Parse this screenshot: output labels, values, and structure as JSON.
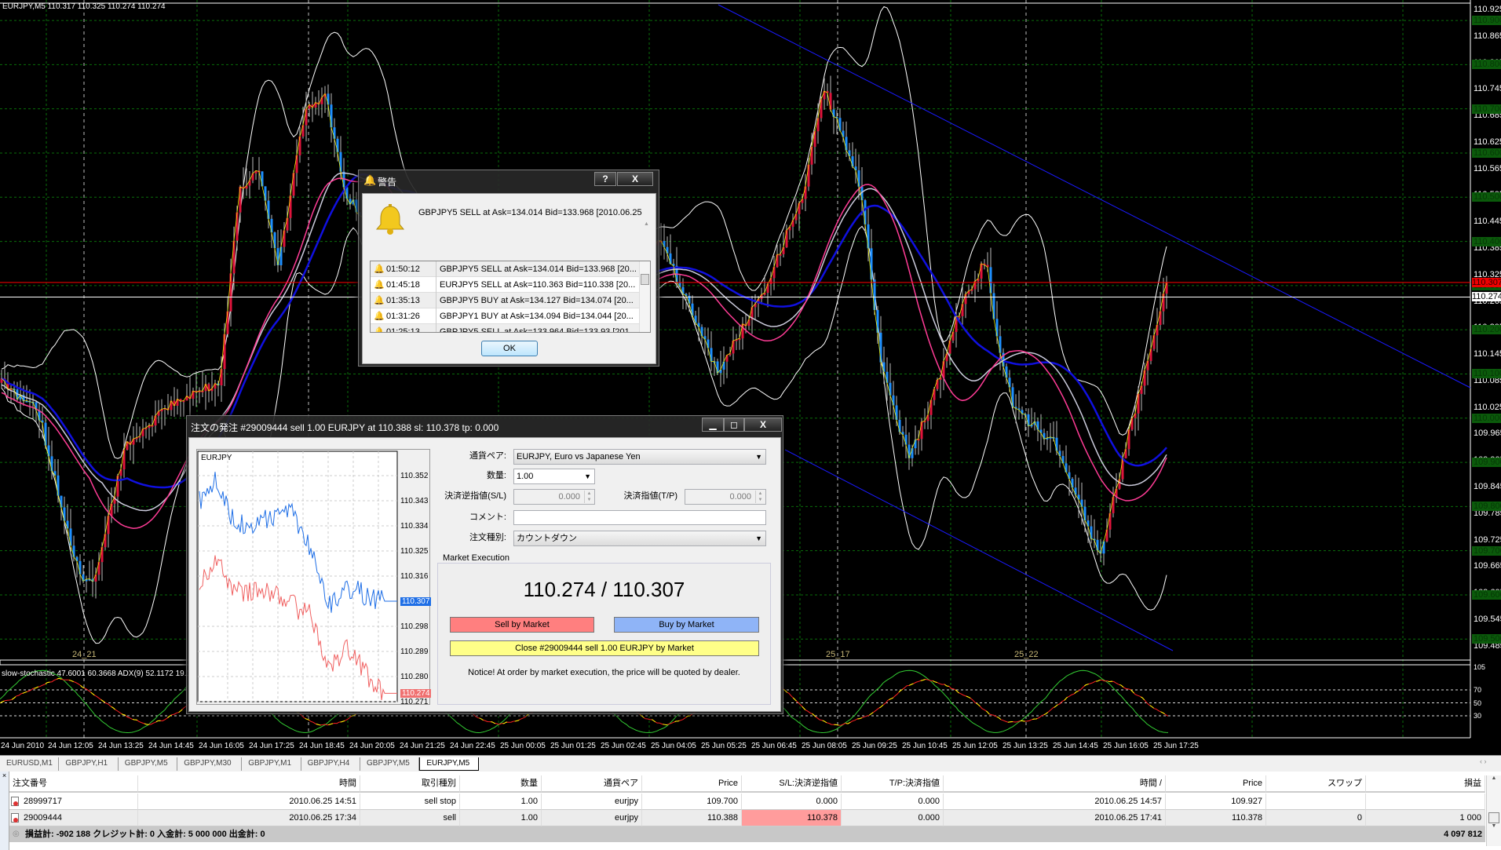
{
  "colors": {
    "bull": "#e0143c",
    "bear": "#1e90ff",
    "band": "#ffffff",
    "ma_slow": "#1010e0",
    "ma_fast": "#ff3c96",
    "grid": "#0a6e0a",
    "channel": "#1a1aff",
    "ask": "#ff0000",
    "bid": "#ffffff",
    "sell_button": "#ff7f7f",
    "buy_button": "#8fb4f7",
    "close_button": "#ffff88"
  },
  "chart": {
    "info": "EURJPY,M5  110.317 110.325 110.274 110.274",
    "price_labels": [
      "110.925",
      "110.865",
      "110.805",
      "110.745",
      "110.685",
      "110.625",
      "110.565",
      "110.505",
      "110.445",
      "110.385",
      "110.325",
      "110.265",
      "110.205",
      "110.145",
      "110.085",
      "110.025",
      "109.965",
      "109.905",
      "109.845",
      "109.785",
      "109.725",
      "109.665",
      "109.605",
      "109.545",
      "109.485"
    ],
    "grid_labels": [
      "110.900",
      "110.800",
      "110.700",
      "110.600",
      "110.500",
      "110.400",
      "110.300",
      "110.200",
      "110.100",
      "110.000",
      "109.900",
      "109.800",
      "109.700",
      "109.600",
      "109.500"
    ],
    "ask": "110.307",
    "bid": "110.274",
    "session_labels": [
      {
        "text": "24_21"
      },
      {
        "text": "25_17"
      },
      {
        "text": "25_22"
      }
    ],
    "indicator_label": "slow-stochastic 47.6001 60.3668  ADX(9) 52.1172 19.17",
    "sub_levels": [
      "105",
      "70",
      "50",
      "30"
    ],
    "time_labels": [
      "24 Jun 2010",
      "24 Jun 12:05",
      "24 Jun 13:25",
      "24 Jun 14:45",
      "24 Jun 16:05",
      "24 Jun 17:25",
      "24 Jun 18:45",
      "24 Jun 20:05",
      "24 Jun 21:25",
      "24 Jun 22:45",
      "25 Jun 00:05",
      "25 Jun 01:25",
      "25 Jun 02:45",
      "25 Jun 04:05",
      "25 Jun 05:25",
      "25 Jun 06:45",
      "25 Jun 08:05",
      "25 Jun 09:25",
      "25 Jun 10:45",
      "25 Jun 12:05",
      "25 Jun 13:25",
      "25 Jun 14:45",
      "25 Jun 16:05",
      "25 Jun 17:25"
    ]
  },
  "alert": {
    "title": "警告",
    "help": "?",
    "close": "X",
    "message": "GBPJPY5 SELL at Ask=134.014 Bid=133.968 [2010.06.25",
    "rows": [
      {
        "time": "01:50:12",
        "text": "GBPJPY5 SELL at Ask=134.014 Bid=133.968 [20..."
      },
      {
        "time": "01:45:18",
        "text": "EURJPY5 SELL at Ask=110.363 Bid=110.338 [20..."
      },
      {
        "time": "01:35:13",
        "text": "GBPJPY5 BUY at Ask=134.127 Bid=134.074 [20..."
      },
      {
        "time": "01:31:26",
        "text": "GBPJPY1 BUY at Ask=134.094 Bid=134.044 [20..."
      },
      {
        "time": "01:25:13",
        "text": "GBPJPY5 SELL at Ask=133.964 Bid=133.93 [201..."
      }
    ],
    "ok": "OK"
  },
  "order": {
    "title": "注文の発注  #29009444 sell 1.00 EURJPY at 110.388 sl: 110.378 tp: 0.000",
    "mini_chart": {
      "symbol": "EURJPY",
      "labels": [
        "110.352",
        "110.343",
        "110.334",
        "110.325",
        "110.316",
        "110.298",
        "110.289",
        "110.280",
        "110.271"
      ],
      "ask": "110.307",
      "bid": "110.274"
    },
    "symbol_label": "通貨ペア:",
    "symbol_value": "EURJPY, Euro vs Japanese Yen",
    "volume_label": "数量:",
    "volume_value": "1.00",
    "sl_label": "決済逆指値(S/L)",
    "sl_value": "0.000",
    "tp_label": "決済指値(T/P)",
    "tp_value": "0.000",
    "comment_label": "コメント:",
    "comment_value": "",
    "type_label": "注文種別:",
    "type_value": "カウントダウン",
    "group_label": "Market Execution",
    "bid": "110.274",
    "ask": "110.307",
    "sep": " / ",
    "sell": "Sell by Market",
    "buy": "Buy by Market",
    "close": "Close  #29009444 sell 1.00 EURJPY by Market",
    "notice": "Notice! At order by market execution, the price will be quoted by dealer."
  },
  "tabs": [
    "EURUSD,M1",
    "GBPJPY,H1",
    "GBPJPY,M5",
    "GBPJPY,M30",
    "GBPJPY,M1",
    "GBPJPY,H4",
    "GBPJPY,M5",
    "EURJPY,M5"
  ],
  "active_tab": "EURJPY,M5",
  "terminal": {
    "headers": [
      "注文番号",
      "時間",
      "取引種別",
      "数量",
      "通貨ペア",
      "Price",
      "S/L:決済逆指値",
      "T/P:決済指値",
      "時間  /",
      "Price",
      "スワップ",
      "損益"
    ],
    "rows": [
      [
        "28999717",
        "2010.06.25 14:51",
        "sell stop",
        "1.00",
        "eurjpy",
        "109.700",
        "0.000",
        "0.000",
        "2010.06.25 14:57",
        "109.927",
        "",
        ""
      ],
      [
        "29009444",
        "2010.06.25 17:34",
        "sell",
        "1.00",
        "eurjpy",
        "110.388",
        "110.378",
        "0.000",
        "2010.06.25 17:41",
        "110.378",
        "0",
        "1 000"
      ]
    ],
    "summary": "損益計: -902 188  クレジット計: 0  入金計: 5 000 000  出金計: 0",
    "total": "4 097 812"
  }
}
